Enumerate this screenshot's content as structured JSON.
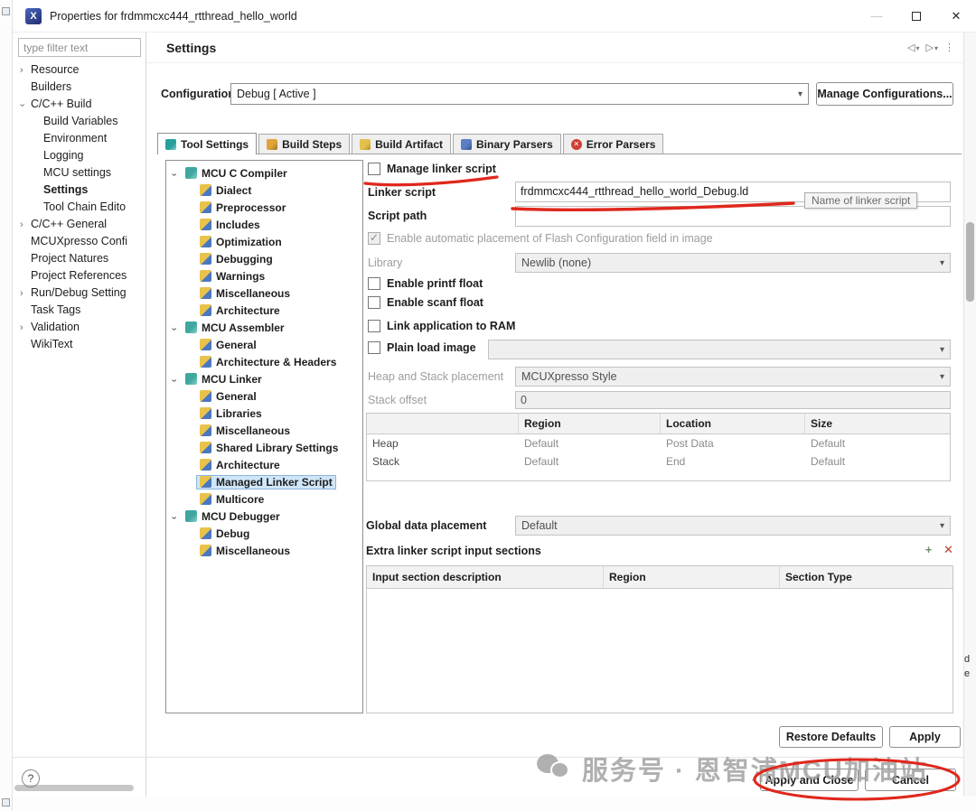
{
  "window": {
    "title": "Properties for frdmmcxc444_rtthread_hello_world",
    "page_title": "Settings"
  },
  "icons": {
    "logo": "X",
    "minimize": "—",
    "close": "✕",
    "chevron": "▾",
    "caret": "▾",
    "back": "◁",
    "forward": "▷",
    "overflow": "⋮",
    "plus": "+",
    "delete": "✕",
    "help": "?"
  },
  "colors": {
    "annotation_red": "#e0271c",
    "selection_blue": "#cfe6f8"
  },
  "sidebar": {
    "filter_placeholder": "type filter text",
    "items": [
      {
        "label": "Resource",
        "expand": "closed"
      },
      {
        "label": "Builders"
      },
      {
        "label": "C/C++ Build",
        "expand": "open"
      },
      {
        "label": "Build Variables",
        "level": 1
      },
      {
        "label": "Environment",
        "level": 1
      },
      {
        "label": "Logging",
        "level": 1
      },
      {
        "label": "MCU settings",
        "level": 1
      },
      {
        "label": "Settings",
        "level": 1,
        "selected": true,
        "name": "sidebar-item-settings"
      },
      {
        "label": "Tool Chain Edito",
        "level": 1
      },
      {
        "label": "C/C++ General",
        "expand": "closed"
      },
      {
        "label": "MCUXpresso Confi"
      },
      {
        "label": "Project Natures"
      },
      {
        "label": "Project References"
      },
      {
        "label": "Run/Debug Setting",
        "expand": "closed"
      },
      {
        "label": "Task Tags"
      },
      {
        "label": "Validation",
        "expand": "closed"
      },
      {
        "label": "WikiText"
      }
    ]
  },
  "config": {
    "label": "Configuration:",
    "value": "Debug  [ Active ]",
    "manage_button": "Manage Configurations..."
  },
  "tabs": [
    {
      "label": "Tool Settings",
      "kind": "tool",
      "selected": true,
      "name": "tab-tool-settings"
    },
    {
      "label": "Build Steps",
      "kind": "steps",
      "name": "tab-build-steps"
    },
    {
      "label": "Build Artifact",
      "kind": "artifact",
      "name": "tab-build-artifact"
    },
    {
      "label": "Binary Parsers",
      "kind": "binary",
      "name": "tab-binary-parsers"
    },
    {
      "label": "Error Parsers",
      "kind": "error",
      "name": "tab-error-parsers"
    }
  ],
  "tool_tree": [
    {
      "label": "MCU C Compiler",
      "kind": "group",
      "expand": "open"
    },
    {
      "label": "Dialect",
      "kind": "leaf",
      "level": 1
    },
    {
      "label": "Preprocessor",
      "kind": "leaf",
      "level": 1
    },
    {
      "label": "Includes",
      "kind": "leaf",
      "level": 1
    },
    {
      "label": "Optimization",
      "kind": "leaf",
      "level": 1
    },
    {
      "label": "Debugging",
      "kind": "leaf",
      "level": 1
    },
    {
      "label": "Warnings",
      "kind": "leaf",
      "level": 1
    },
    {
      "label": "Miscellaneous",
      "kind": "leaf",
      "level": 1
    },
    {
      "label": "Architecture",
      "kind": "leaf",
      "level": 1
    },
    {
      "label": "MCU Assembler",
      "kind": "group",
      "expand": "open"
    },
    {
      "label": "General",
      "kind": "leaf",
      "level": 1
    },
    {
      "label": "Architecture & Headers",
      "kind": "leaf",
      "level": 1
    },
    {
      "label": "MCU Linker",
      "kind": "group",
      "expand": "open"
    },
    {
      "label": "General",
      "kind": "leaf",
      "level": 1
    },
    {
      "label": "Libraries",
      "kind": "leaf",
      "level": 1
    },
    {
      "label": "Miscellaneous",
      "kind": "leaf",
      "level": 1
    },
    {
      "label": "Shared Library Settings",
      "kind": "leaf",
      "level": 1
    },
    {
      "label": "Architecture",
      "kind": "leaf",
      "level": 1
    },
    {
      "label": "Managed Linker Script",
      "kind": "leaf",
      "level": 1,
      "selected": true,
      "name": "tool-tree-item-managed-linker-script"
    },
    {
      "label": "Multicore",
      "kind": "leaf",
      "level": 1
    },
    {
      "label": "MCU Debugger",
      "kind": "group",
      "expand": "open"
    },
    {
      "label": "Debug",
      "kind": "leaf",
      "level": 1
    },
    {
      "label": "Miscellaneous",
      "kind": "leaf",
      "level": 1
    }
  ],
  "form": {
    "manage_linker_label": "Manage linker script",
    "linker_script_label": "Linker script",
    "linker_script_value": "frdmmcxc444_rtthread_hello_world_Debug.ld",
    "linker_tooltip": "Name of linker script",
    "script_path_label": "Script path",
    "script_path_value": "",
    "flash_config_label": "Enable automatic placement of Flash Configuration field in image",
    "library_label": "Library",
    "library_value": "Newlib (none)",
    "printf_label": "Enable printf float",
    "scanf_label": "Enable scanf float",
    "link_ram_label": "Link application to RAM",
    "plain_load_label": "Plain load image",
    "plain_load_value": "",
    "heap_stack_label": "Heap and Stack placement",
    "heap_stack_value": "MCUXpresso Style",
    "stack_offset_label": "Stack offset",
    "stack_offset_value": "0",
    "global_data_label": "Global data placement",
    "global_data_value": "Default",
    "extra_sections_label": "Extra linker script input sections"
  },
  "placement_table": {
    "headers": [
      "",
      "Region",
      "Location",
      "Size"
    ],
    "rows": [
      [
        "Heap",
        "Default",
        "Post Data",
        "Default"
      ],
      [
        "Stack",
        "Default",
        "End",
        "Default"
      ]
    ]
  },
  "extra_table": {
    "headers": [
      "Input section description",
      "Region",
      "Section Type"
    ]
  },
  "buttons": {
    "restore": "Restore Defaults",
    "apply": "Apply",
    "apply_close": "Apply and Close",
    "cancel": "Cancel"
  },
  "watermark": {
    "text": "服务号 · 恩智浦MCU加油站"
  },
  "edge_text": [
    "d",
    "e"
  ]
}
